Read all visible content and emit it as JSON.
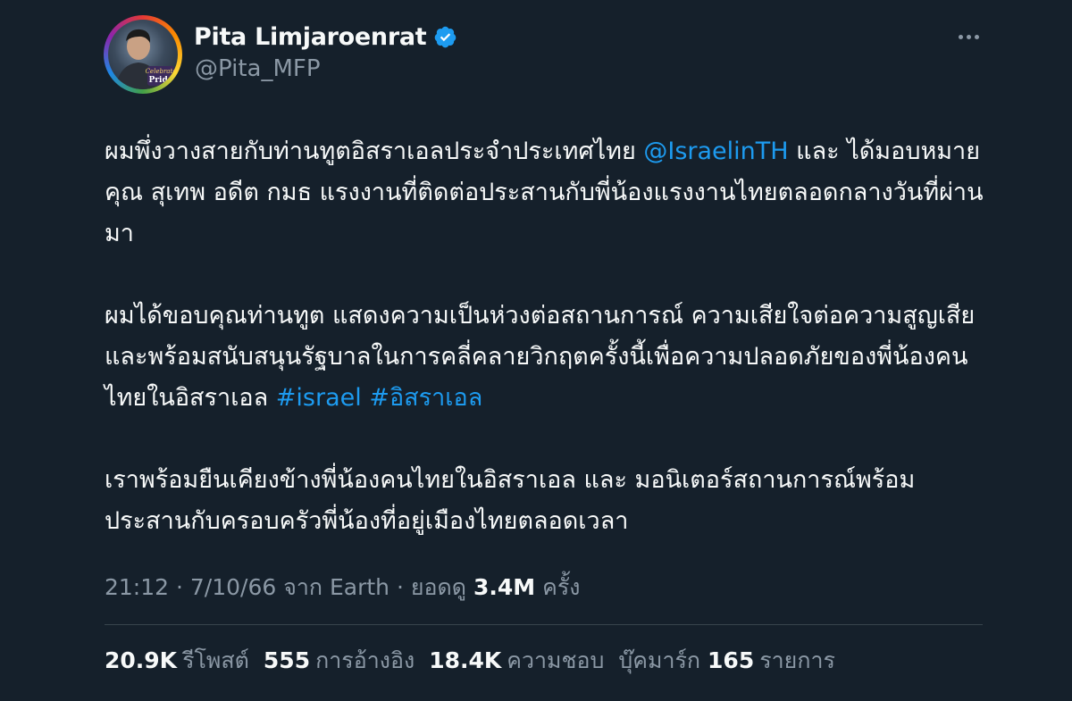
{
  "author": {
    "display_name": "Pita Limjaroenrat",
    "handle": "@Pita_MFP",
    "avatar_badge_text": "Celebrate Pride",
    "verified_icon": "verified-badge-icon"
  },
  "menu": {
    "icon": "more-horizontal-icon"
  },
  "body": {
    "p1_text_a": "ผมพึ่งวางสายกับท่านทูตอิสราเอลประจำประเทศไทย ",
    "p1_mention": "@IsraelinTH",
    "p1_text_b": " และ ได้มอบหมาย คุณ สุเทพ อดีต กมธ แรงงานที่ติดต่อประสานกับพี่น้องแรงงานไทยตลอดกลางวันที่ผ่านมา",
    "p2_text": "ผมได้ขอบคุณท่านทูต แสดงความเป็นห่วงต่อสถานการณ์ ความเสียใจต่อความสูญเสียและพร้อมสนับสนุนรัฐบาลในการคลี่คลายวิกฤตครั้งนี้เพื่อความปลอดภัยของพี่น้องคนไทยในอิสราเอล ",
    "p2_hashtag1": "#israel",
    "p2_hashtag2": "#อิสราเอล",
    "p3_text": "เราพร้อมยืนเคียงข้างพี่น้องคนไทยในอิสราเอล และ มอนิเตอร์สถานการณ์พร้อมประสานกับครอบครัวพี่น้องที่อยู่เมืองไทยตลอดเวลา"
  },
  "meta": {
    "time": "21:12",
    "separator": " · ",
    "date": "7/10/66",
    "source_prefix": " จาก ",
    "source": "Earth",
    "views_label": "ยอดดู",
    "views_count": "3.4M",
    "views_suffix": "ครั้ง"
  },
  "stats": {
    "retweets_count": "20.9K",
    "retweets_label": "รีโพสต์",
    "quotes_count": "555",
    "quotes_label": "การอ้างอิง",
    "likes_count": "18.4K",
    "likes_label": "ความชอบ",
    "bookmarks_label_prefix": "บุ๊คมาร์ก",
    "bookmarks_count": "165",
    "bookmarks_label_suffix": "รายการ"
  },
  "colors": {
    "background": "#15202b",
    "text": "#f7f9f9",
    "secondary": "#8b98a5",
    "link": "#1d9bf0",
    "divider": "#38444d"
  }
}
